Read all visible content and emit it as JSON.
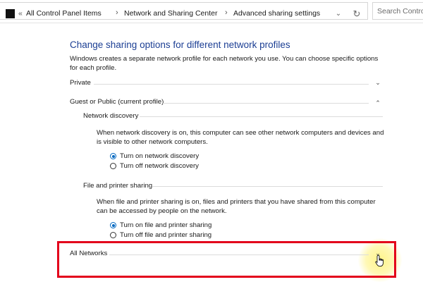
{
  "address_bar": {
    "back_glyph": "«",
    "crumbs": [
      "All Control Panel Items",
      "Network and Sharing Center",
      "Advanced sharing settings"
    ],
    "separator": "›",
    "search_placeholder": "Search Control Pa"
  },
  "header": {
    "title": "Change sharing options for different network profiles",
    "description": "Windows creates a separate network profile for each network you use. You can choose specific options for each profile."
  },
  "profiles": {
    "private": {
      "label": "Private"
    },
    "guest_public": {
      "label": "Guest or Public (current profile)"
    },
    "all_networks": {
      "label": "All Networks"
    }
  },
  "network_discovery": {
    "heading": "Network discovery",
    "description": "When network discovery is on, this computer can see other network computers and devices and is visible to other network computers.",
    "option_on": "Turn on network discovery",
    "option_off": "Turn off network discovery",
    "selected": "on"
  },
  "file_printer_sharing": {
    "heading": "File and printer sharing",
    "description": "When file and printer sharing is on, files and printers that you have shared from this computer can be accessed by people on the network.",
    "option_on": "Turn on file and printer sharing",
    "option_off": "Turn off file and printer sharing",
    "selected": "on"
  },
  "colors": {
    "title_blue": "#1c3f94",
    "radio_blue": "#0067c0",
    "highlight_red": "#e3001b"
  },
  "icons": {
    "expand": "chevron-down-icon",
    "collapse": "chevron-up-icon",
    "refresh": "refresh-icon",
    "cursor": "hand-pointer-icon"
  }
}
